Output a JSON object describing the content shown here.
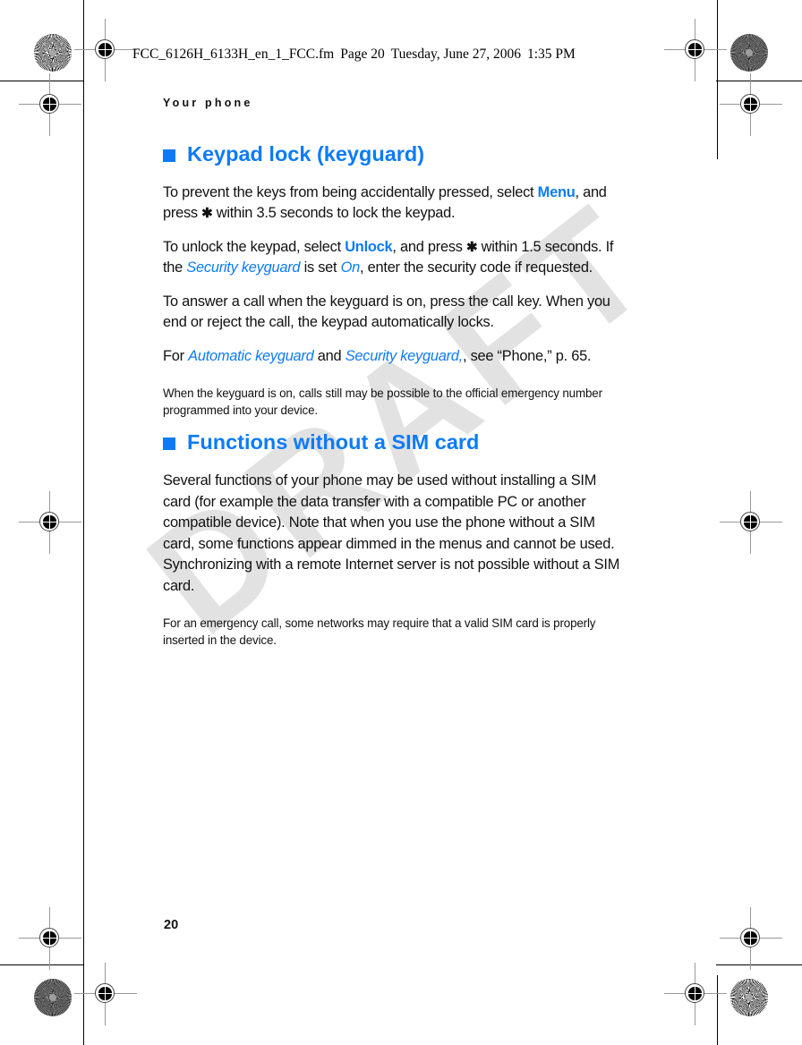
{
  "file_header": {
    "filename": "FCC_6126H_6133H_en_1_FCC.fm",
    "page_label": "Page 20",
    "date": "Tuesday, June 27, 2006",
    "time": "1:35 PM"
  },
  "watermark": "DRAFT",
  "running_head": "Your phone",
  "page_number": "20",
  "colors": {
    "accent_blue": "#0d7bf7",
    "body_text": "#111111",
    "watermark_gray": "#e2e2e2"
  },
  "sections": [
    {
      "id": "keypad-lock",
      "heading": "Keypad lock (keyguard)",
      "paragraphs": [
        {
          "type": "body",
          "runs": [
            {
              "text": "To prevent the keys from being accidentally pressed, select ",
              "style": "plain"
            },
            {
              "text": "Menu",
              "style": "ui"
            },
            {
              "text": ", and press ",
              "style": "plain"
            },
            {
              "text": "✱",
              "style": "asterisk"
            },
            {
              "text": " within 3.5 seconds to lock the keypad.",
              "style": "plain"
            }
          ]
        },
        {
          "type": "body",
          "runs": [
            {
              "text": "To unlock the keypad, select ",
              "style": "plain"
            },
            {
              "text": "Unlock",
              "style": "ui"
            },
            {
              "text": ", and press ",
              "style": "plain"
            },
            {
              "text": "✱",
              "style": "asterisk"
            },
            {
              "text": " within 1.5 seconds. If the ",
              "style": "plain"
            },
            {
              "text": "Security keyguard",
              "style": "param"
            },
            {
              "text": " is set ",
              "style": "plain"
            },
            {
              "text": "On",
              "style": "param"
            },
            {
              "text": ", enter the security code if requested.",
              "style": "plain"
            }
          ]
        },
        {
          "type": "body",
          "runs": [
            {
              "text": "To answer a call when the keyguard is on, press the call key. When you end or reject the call, the keypad automatically locks.",
              "style": "plain"
            }
          ]
        },
        {
          "type": "body",
          "runs": [
            {
              "text": "For ",
              "style": "plain"
            },
            {
              "text": "Automatic keyguard",
              "style": "param"
            },
            {
              "text": " and ",
              "style": "plain"
            },
            {
              "text": "Security keyguard,",
              "style": "param"
            },
            {
              "text": ", see “Phone,” p. 65.",
              "style": "plain"
            }
          ]
        },
        {
          "type": "note",
          "runs": [
            {
              "text": "When the keyguard is on, calls still may be possible to the official emergency number programmed into your device.",
              "style": "plain"
            }
          ]
        }
      ]
    },
    {
      "id": "functions-without-sim",
      "heading": "Functions without a SIM card",
      "paragraphs": [
        {
          "type": "body",
          "runs": [
            {
              "text": "Several functions of your phone may be used without installing a SIM card (for example the data transfer with a compatible PC or another compatible device). Note that when you use the phone without a SIM card, some functions appear dimmed in the menus and cannot be used. Synchronizing with a remote Internet server is not possible without a SIM card.",
              "style": "plain"
            }
          ]
        },
        {
          "type": "note",
          "runs": [
            {
              "text": "For an emergency call, some networks may require that a valid SIM card is properly inserted in the device.",
              "style": "plain"
            }
          ]
        }
      ]
    }
  ]
}
